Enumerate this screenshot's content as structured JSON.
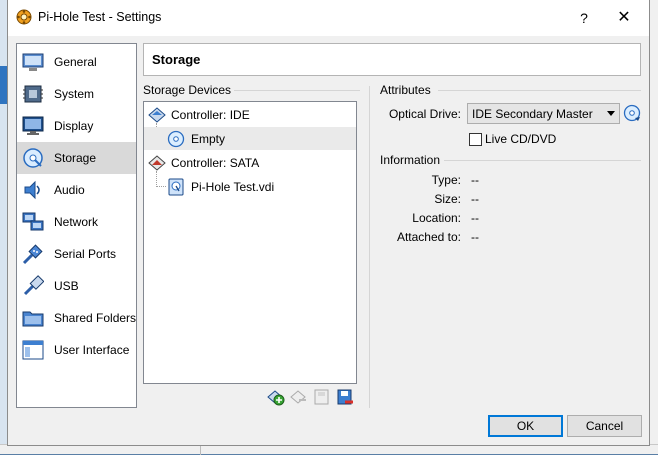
{
  "window": {
    "title": "Pi-Hole Test - Settings",
    "help_glyph": "?",
    "close_glyph": "✕"
  },
  "sidebar": {
    "items": [
      {
        "label": "General",
        "icon": "general-icon",
        "selected": false
      },
      {
        "label": "System",
        "icon": "system-icon",
        "selected": false
      },
      {
        "label": "Display",
        "icon": "display-icon",
        "selected": false
      },
      {
        "label": "Storage",
        "icon": "storage-icon",
        "selected": true
      },
      {
        "label": "Audio",
        "icon": "audio-icon",
        "selected": false
      },
      {
        "label": "Network",
        "icon": "network-icon",
        "selected": false
      },
      {
        "label": "Serial Ports",
        "icon": "serial-ports-icon",
        "selected": false
      },
      {
        "label": "USB",
        "icon": "usb-icon",
        "selected": false
      },
      {
        "label": "Shared Folders",
        "icon": "shared-folders-icon",
        "selected": false
      },
      {
        "label": "User Interface",
        "icon": "user-interface-icon",
        "selected": false
      }
    ]
  },
  "page": {
    "title": "Storage"
  },
  "storage_devices": {
    "label": "Storage Devices",
    "tree": [
      {
        "label": "Controller: IDE",
        "kind": "controller"
      },
      {
        "label": "Empty",
        "kind": "optical",
        "selected": true
      },
      {
        "label": "Controller: SATA",
        "kind": "controller"
      },
      {
        "label": "Pi-Hole Test.vdi",
        "kind": "disk"
      }
    ],
    "toolbar": [
      "add-attachment-icon",
      "remove-attachment-icon",
      "add-controller-icon",
      "remove-controller-icon"
    ]
  },
  "attributes": {
    "label": "Attributes",
    "optical_drive_label": "Optical Drive:",
    "optical_drive_value": "IDE Secondary Master",
    "live_cd_label": "Live CD/DVD",
    "live_cd_checked": false
  },
  "information": {
    "label": "Information",
    "rows": [
      {
        "label": "Type:",
        "value": "--"
      },
      {
        "label": "Size:",
        "value": "--"
      },
      {
        "label": "Location:",
        "value": "--"
      },
      {
        "label": "Attached to:",
        "value": "--"
      }
    ]
  },
  "buttons": {
    "ok": "OK",
    "cancel": "Cancel"
  },
  "colors": {
    "accent": "#0078d7",
    "selection": "#d9d9d9"
  }
}
